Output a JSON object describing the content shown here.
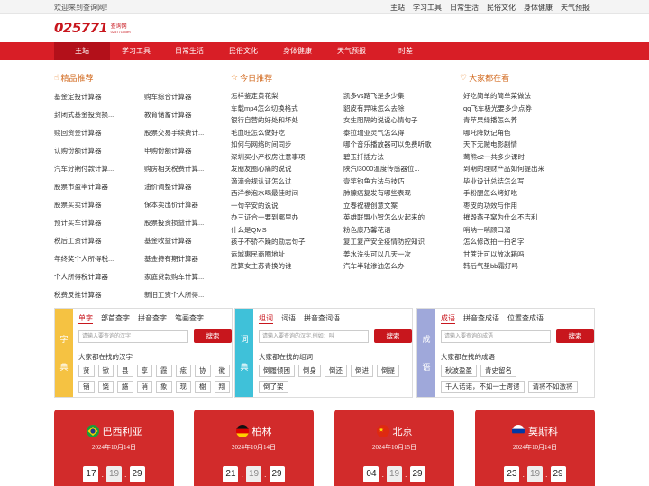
{
  "topbar": {
    "welcome": "欢迎来到查询网！",
    "links": [
      "主站",
      "学习工具",
      "日常生活",
      "民俗文化",
      "身体健康",
      "天气预报"
    ]
  },
  "logo": {
    "number": "025771",
    "cn": "查询网",
    "en": "025771.com"
  },
  "nav": [
    "主站",
    "学习工具",
    "日常生活",
    "民俗文化",
    "身体健康",
    "天气预报",
    "时差"
  ],
  "picks": {
    "title": "精品推荐",
    "items": [
      "基金定投计算器",
      "购车综合计算器",
      "封闭式基金投资损...",
      "教育储蓄计算器",
      "赎回资金计算器",
      "股票交易手续费计...",
      "认购份额计算器",
      "申购份额计算器",
      "汽车分期付款计算...",
      "购房相关税费计算...",
      "股票市盈率计算器",
      "油价调整计算器",
      "股票买卖计算器",
      "保本卖出价计算器",
      "预计买车计算器",
      "股票投资损益计算...",
      "税后工资计算器",
      "基金收益计算器",
      "年终奖个人所得税...",
      "基金持有期计算器",
      "个人所得税计算器",
      "家庭贷款购车计算...",
      "税费反推计算器",
      "新旧工资个人所得..."
    ]
  },
  "today": {
    "title": "今日推荐",
    "col1": [
      "怎样鉴定黄花梨",
      "车载mp4怎么切换格式",
      "银行自营的好处和坏处",
      "毛血旺怎么做好吃",
      "如何与网络时间同步",
      "深圳买小产权房注意事项",
      "发朋友圈心痛的说说",
      "滴滴会规认证怎么过",
      "西洋参泡水喝最佳时间",
      "一句辛安的说说",
      "办三证合一要到哪里办",
      "什么是QMS",
      "孩子不骄不躁的励志句子",
      "运城惠民商圈地址",
      "胜算女主苏青换的谁"
    ],
    "col2": [
      "凯多vs路飞是多少集",
      "貂皮有异味怎么去除",
      "女生阻隔的说说心情句子",
      "泰拉瑞亚灵气怎么得",
      "哪个音乐播放器可以免费听歌",
      "碧玉扦插方法",
      "陕汽l3000温度传感器位...",
      "壹竿钓鱼方法与技巧",
      "肺腺癌复发有哪些表现",
      "立春祝福创意文案",
      "英雄联盟小智怎么火起来的",
      "粉色康乃馨花语",
      "复工复产安全疫情防控知识",
      "姜水洗头可以几天一次",
      "汽车半轴渗油怎么办"
    ]
  },
  "popular": {
    "title": "大家都在看",
    "items": [
      "好吃简单的简单菜做法",
      "qq飞车极光要多少点券",
      "青苹果绿播怎么养",
      "哪吒降妖记角色",
      "天下无贼电影剧情",
      "莺熊c2一共多少课时",
      "到期的理财产品如何提出来",
      "毕业设计总结怎么写",
      "手粉腿怎么烤好吃",
      "枣皮的功效与作用",
      "摧毁燕子窝为什么不吉利",
      "哨呐一哨顾口溜",
      "怎么修改拍一拍名字",
      "甘蔗汁可以放冰箱吗",
      "韩后气垫bb霜好吗"
    ]
  },
  "dict_char": {
    "side": [
      "字",
      "典"
    ],
    "tabs": [
      "单字",
      "部首查字",
      "拼音查字",
      "笔画查字"
    ],
    "placeholder": "请输入要查询的汉字",
    "button": "搜索",
    "label": "大家都在找的汉字",
    "chips": [
      "贤",
      "锨",
      "县",
      "享",
      "霞",
      "痃",
      "协",
      "徽",
      "销",
      "饶",
      "觞",
      "消",
      "象",
      "现",
      "榭",
      "翔"
    ]
  },
  "dict_word": {
    "side": [
      "词",
      "典"
    ],
    "tabs": [
      "组词",
      "词语",
      "拼音查词语"
    ],
    "placeholder": "请输入要查询的汉字,例如：叫",
    "button": "搜索",
    "label": "大家都在找的组词",
    "chips": [
      "倒履倾困",
      "倒身",
      "倒还",
      "倒进",
      "倒提",
      "倒了架"
    ]
  },
  "dict_idiom": {
    "side": [
      "成",
      "语"
    ],
    "tabs": [
      "成语",
      "拼音查成语",
      "位置查成语"
    ],
    "placeholder": "请输入要查询的成语",
    "button": "搜索",
    "label": "大家都在找的成语",
    "chips": [
      "秋波盈盈",
      "青史留名",
      "千人诺诺，不如一士谔谔",
      "请将不如激将"
    ]
  },
  "cities": [
    {
      "name": "巴西利亚",
      "date": "2024年10月14日",
      "h": "17",
      "m": "19",
      "s": "29"
    },
    {
      "name": "柏林",
      "date": "2024年10月14日",
      "h": "21",
      "m": "19",
      "s": "29"
    },
    {
      "name": "北京",
      "date": "2024年10月15日",
      "h": "04",
      "m": "19",
      "s": "29"
    },
    {
      "name": "莫斯科",
      "date": "2024年10月14日",
      "h": "23",
      "m": "19",
      "s": "29"
    }
  ],
  "colors": {
    "brand_red": "#d81e26",
    "orange": "#d2691e",
    "char_side": "#f5c242",
    "word_side": "#3fc1d9",
    "idiom_side": "#9fa8da"
  }
}
